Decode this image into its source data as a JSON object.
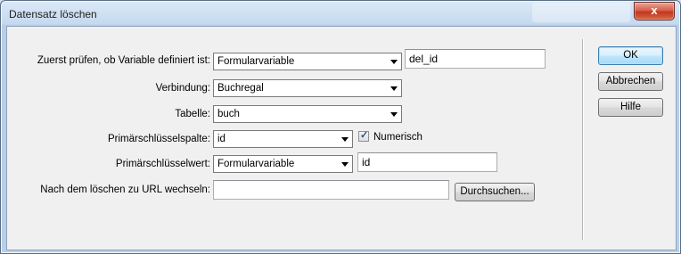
{
  "window": {
    "title": "Datensatz löschen",
    "close_label": "x"
  },
  "form": {
    "check_variable": {
      "label": "Zuerst prüfen, ob Variable definiert ist:",
      "select_value": "Formularvariable",
      "text_value": "del_id"
    },
    "connection": {
      "label": "Verbindung:",
      "select_value": "Buchregal"
    },
    "table": {
      "label": "Tabelle:",
      "select_value": "buch"
    },
    "primary_key_column": {
      "label": "Primärschlüsselspalte:",
      "select_value": "id",
      "checkbox_label": "Numerisch",
      "checked": true
    },
    "primary_key_value": {
      "label": "Primärschlüsselwert:",
      "select_value": "Formularvariable",
      "text_value": "id"
    },
    "redirect_url": {
      "label": "Nach dem löschen zu URL wechseln:",
      "text_value": "",
      "browse_label": "Durchsuchen..."
    }
  },
  "buttons": {
    "ok": "OK",
    "cancel": "Abbrechen",
    "help": "Hilfe"
  }
}
